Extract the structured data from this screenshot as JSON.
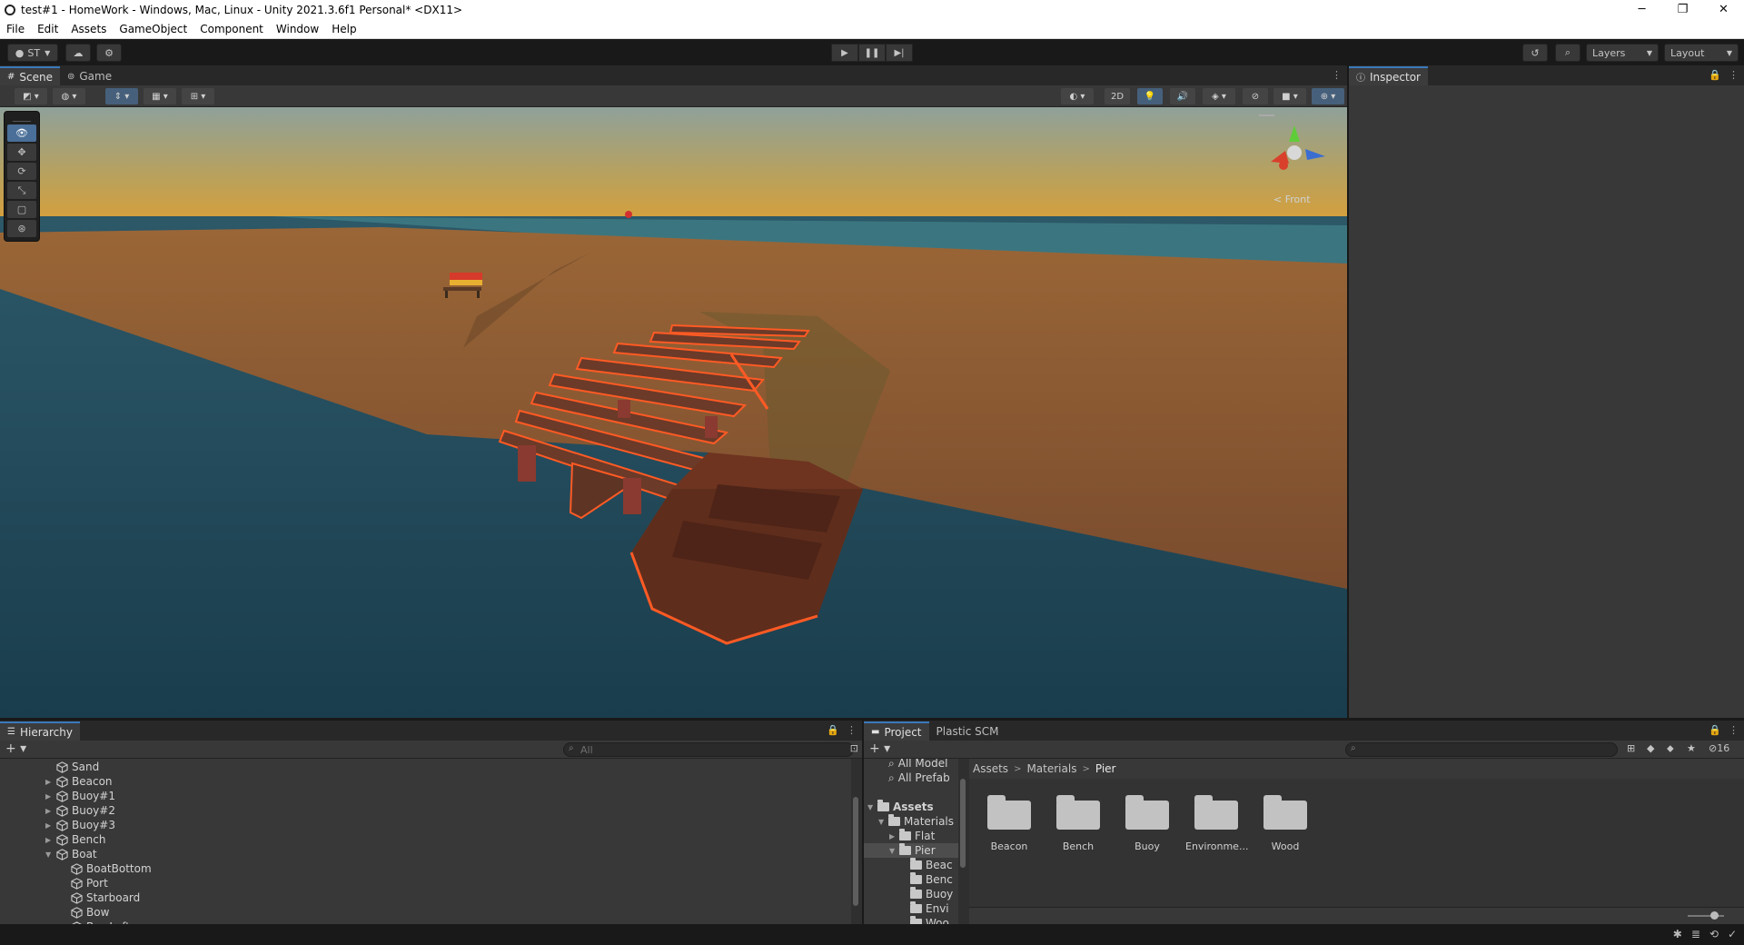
{
  "window": {
    "title": "test#1 - HomeWork - Windows, Mac, Linux - Unity 2021.3.6f1 Personal* <DX11>",
    "min": "─",
    "max": "❐",
    "close": "✕"
  },
  "menu": [
    "File",
    "Edit",
    "Assets",
    "GameObject",
    "Component",
    "Window",
    "Help"
  ],
  "toolbar": {
    "account": "ST",
    "layers": "Layers",
    "layout": "Layout"
  },
  "scene_tabs": [
    {
      "label": "Scene",
      "icon": "grid-icon"
    },
    {
      "label": "Game",
      "icon": "gamepad-icon"
    }
  ],
  "scene_toolbar": {
    "mode_2d": "2D"
  },
  "gizmo": {
    "view": "< Front"
  },
  "inspector": {
    "tab": "Inspector"
  },
  "hierarchy": {
    "tab": "Hierarchy",
    "search_placeholder": "All",
    "items": [
      {
        "name": "Sand",
        "indent": 0,
        "arrow": ""
      },
      {
        "name": "Beacon",
        "indent": 0,
        "arrow": "▶"
      },
      {
        "name": "Buoy#1",
        "indent": 0,
        "arrow": "▶"
      },
      {
        "name": "Buoy#2",
        "indent": 0,
        "arrow": "▶"
      },
      {
        "name": "Buoy#3",
        "indent": 0,
        "arrow": "▶"
      },
      {
        "name": "Bench",
        "indent": 0,
        "arrow": "▶"
      },
      {
        "name": "Boat",
        "indent": 0,
        "arrow": "▼"
      },
      {
        "name": "BoatBottom",
        "indent": 1,
        "arrow": ""
      },
      {
        "name": "Port",
        "indent": 1,
        "arrow": ""
      },
      {
        "name": "Starboard",
        "indent": 1,
        "arrow": ""
      },
      {
        "name": "Bow",
        "indent": 1,
        "arrow": ""
      },
      {
        "name": "BowLeft",
        "indent": 1,
        "arrow": ""
      }
    ]
  },
  "project": {
    "tabs": [
      "Project",
      "Plastic SCM"
    ],
    "hidden_count": "16",
    "tree": [
      {
        "name": "All Model",
        "indent": 1,
        "arrow": "",
        "kind": "search"
      },
      {
        "name": "All Prefab",
        "indent": 1,
        "arrow": "",
        "kind": "search"
      },
      {
        "name": "Assets",
        "indent": 0,
        "arrow": "▼",
        "kind": "folder",
        "bold": true
      },
      {
        "name": "Materials",
        "indent": 1,
        "arrow": "▼",
        "kind": "folder"
      },
      {
        "name": "Flat",
        "indent": 2,
        "arrow": "▶",
        "kind": "folder"
      },
      {
        "name": "Pier",
        "indent": 2,
        "arrow": "▼",
        "kind": "folder",
        "selected": true
      },
      {
        "name": "Beac",
        "indent": 3,
        "arrow": "",
        "kind": "folder"
      },
      {
        "name": "Benc",
        "indent": 3,
        "arrow": "",
        "kind": "folder"
      },
      {
        "name": "Buoy",
        "indent": 3,
        "arrow": "",
        "kind": "folder"
      },
      {
        "name": "Envi",
        "indent": 3,
        "arrow": "",
        "kind": "folder"
      },
      {
        "name": "Woo",
        "indent": 3,
        "arrow": "",
        "kind": "folder"
      }
    ],
    "breadcrumb": [
      "Assets",
      "Materials",
      "Pier"
    ],
    "assets": [
      "Beacon",
      "Bench",
      "Buoy",
      "Environme...",
      "Wood"
    ]
  },
  "colors": {
    "accent": "#3a79bb",
    "sand": "#8a5a36",
    "water": "#1f4a5a",
    "sky_top": "#8fa19a",
    "sky_horizon": "#d9a038",
    "selection_outline": "#ff5a24"
  }
}
